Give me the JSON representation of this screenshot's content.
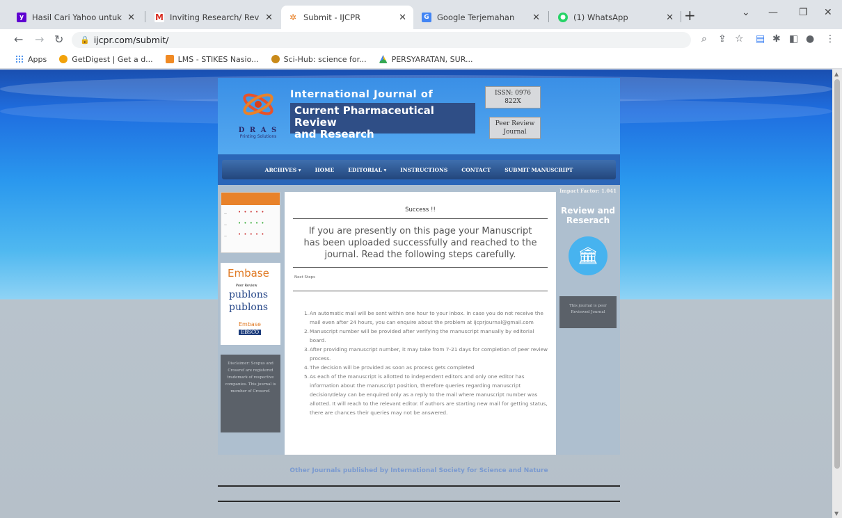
{
  "browser": {
    "tabs": [
      {
        "title": "Hasil Cari Yahoo untuk gmai",
        "favicon": "yahoo-icon",
        "color": "#5f01d1"
      },
      {
        "title": "Inviting Research/ Review Pa",
        "favicon": "gmail-icon",
        "color": "#d93025"
      },
      {
        "title": "Submit - IJCPR",
        "favicon": "ijcpr-icon",
        "color": "#e8822a",
        "active": true
      },
      {
        "title": "Google Terjemahan",
        "favicon": "translate-icon",
        "color": "#4285f4"
      },
      {
        "title": "(1) WhatsApp",
        "favicon": "whatsapp-icon",
        "color": "#25d366"
      }
    ],
    "url": "ijcpr.com/submit/",
    "bookmarks": [
      {
        "label": "Apps",
        "icon": "apps-grid-icon"
      },
      {
        "label": "GetDigest | Get a d...",
        "icon": "getdigest-icon"
      },
      {
        "label": "LMS - STIKES Nasio...",
        "icon": "lms-icon"
      },
      {
        "label": "Sci-Hub: science for...",
        "icon": "scihub-icon"
      },
      {
        "label": "PERSYARATAN, SUR...",
        "icon": "drive-icon"
      }
    ]
  },
  "site": {
    "logo_text": "D R A S",
    "logo_subtext": "Printing Solutions",
    "title_line1": "International Journal of",
    "title_line2": "Current Pharmaceutical Review",
    "title_line3": "and Research",
    "issn": "ISSN: 0976 822X",
    "peer": "Peer Review Journal",
    "nav": [
      "ARCHIVES ▾",
      "HOME",
      "EDITORIAL ▾",
      "INSTRUCTIONS",
      "CONTACT",
      "SUBMIT MANUSCRIPT"
    ],
    "embase": "Embase",
    "peer_badge": "Peer Review",
    "publons": "publons",
    "embase_small": "Embase",
    "ebsco": "EBSCO",
    "left_dark_text": "Disclaimer: Scopus and Crossref are registered trademark of respective companies. This journal is member of Crossref.",
    "impact": "Impact Factor: 1.041",
    "review_research": "Review and Reserach",
    "right_dark_text": "This journal is peer Reviewed Journal",
    "success_title": "Success !!",
    "headline": "If you are presently on this page your Manuscript has been uploaded successfully and reached to the journal. Read the following steps carefully.",
    "next_steps": "Next Steps",
    "steps": [
      "An automatic mail will be sent within one hour to your inbox. In case you do not receive the mail even after 24 hours, you can enquire about the problem at ijcprjournal@gmail.com",
      "Manuscript number will be provided after verifying the manuscript manually by editorial board.",
      "After providing manuscript number, it may take from 7-21 days for completion of peer review process.",
      "The decision will be provided as soon as process gets completed",
      "As each of the manuscript is allotted to independent editors and only one editor has information about the manuscript position, therefore queries regarding manuscript decision/delay can be enquired only as a reply to the mail where manuscript number was allotted. It will reach to the relevant editor. If authors are starting new mail for getting status, there are chances their queries may not be answered."
    ],
    "other_journals": "Other Journals published by International Society for Science and Nature"
  }
}
